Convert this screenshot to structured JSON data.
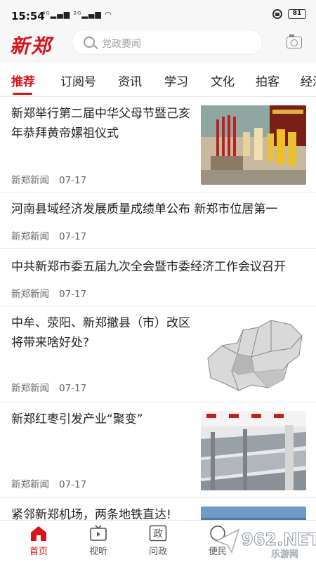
{
  "status_bar": {
    "time": "15:54",
    "signals": "⁴ᴳ▂▄▆ ²ᴳ▂▄▆ ◠",
    "battery": "81"
  },
  "header": {
    "logo": "新郑",
    "search_placeholder": "党政要闻"
  },
  "tabs": [
    {
      "label": "推荐"
    },
    {
      "label": "订阅号"
    },
    {
      "label": "资讯"
    },
    {
      "label": "学习"
    },
    {
      "label": "文化"
    },
    {
      "label": "拍客"
    },
    {
      "label": "经济"
    }
  ],
  "news": [
    {
      "title": "新郑举行第二届中华父母节暨己亥年恭拜黄帝嫘祖仪式",
      "source": "新郑新闻",
      "date": "07-17"
    },
    {
      "title": "河南县域经济发展质量成绩单公布 新郑市位居第一",
      "source": "新郑新闻",
      "date": "07-17"
    },
    {
      "title": "中共新郑市委五届九次全会暨市委经济工作会议召开",
      "source": "新郑新闻",
      "date": "07-17"
    },
    {
      "title": "中牟、荥阳、新郑撤县（市）改区 将带来啥好处?",
      "source": "新郑新闻",
      "date": "07-17"
    },
    {
      "title": "新郑红枣引发产业“聚变”",
      "source": "新郑新闻",
      "date": "07-17"
    },
    {
      "title": "紧邻新郑机场，两条地铁直达!",
      "source": "",
      "date": ""
    }
  ],
  "bottom_nav": [
    {
      "label": "首页",
      "icon": "home-icon"
    },
    {
      "label": "视听",
      "icon": "tv-icon"
    },
    {
      "label": "问政",
      "icon": "zheng-icon"
    },
    {
      "label": "便民",
      "icon": "service-icon"
    }
  ],
  "nav_icon_glyph": "政",
  "watermark": {
    "brand": "962.NET",
    "sub": "乐游网"
  },
  "colors": {
    "accent": "#d7141a",
    "text": "#222222",
    "meta": "#666666"
  }
}
